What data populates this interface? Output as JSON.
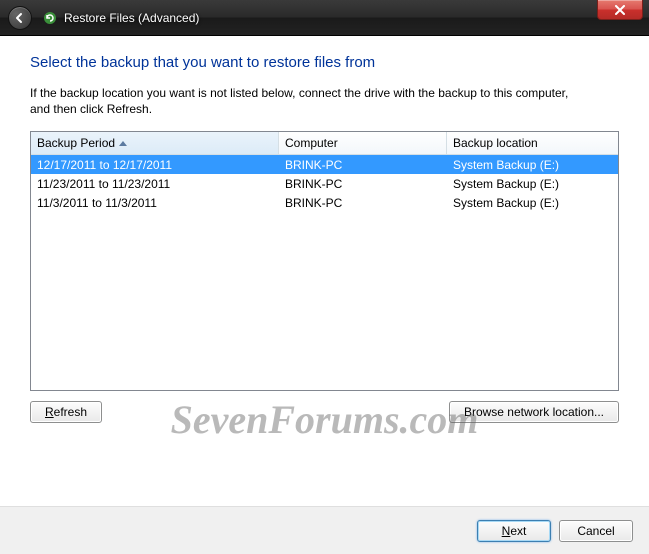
{
  "titlebar": {
    "title": "Restore Files (Advanced)"
  },
  "heading": "Select the backup that you want to restore files from",
  "instructions": "If the backup location you want is not listed below, connect the drive with the backup to this computer, and then click Refresh.",
  "columns": {
    "period": "Backup Period",
    "computer": "Computer",
    "location": "Backup location"
  },
  "rows": [
    {
      "period": "12/17/2011 to 12/17/2011",
      "computer": "BRINK-PC",
      "location": "System Backup (E:)",
      "selected": true
    },
    {
      "period": "11/23/2011 to 11/23/2011",
      "computer": "BRINK-PC",
      "location": "System Backup (E:)",
      "selected": false
    },
    {
      "period": "11/3/2011 to 11/3/2011",
      "computer": "BRINK-PC",
      "location": "System Backup (E:)",
      "selected": false
    }
  ],
  "buttons": {
    "refresh": "Refresh",
    "browse": "Browse network location...",
    "next": "Next",
    "cancel": "Cancel"
  },
  "watermark": "SevenForums.com"
}
